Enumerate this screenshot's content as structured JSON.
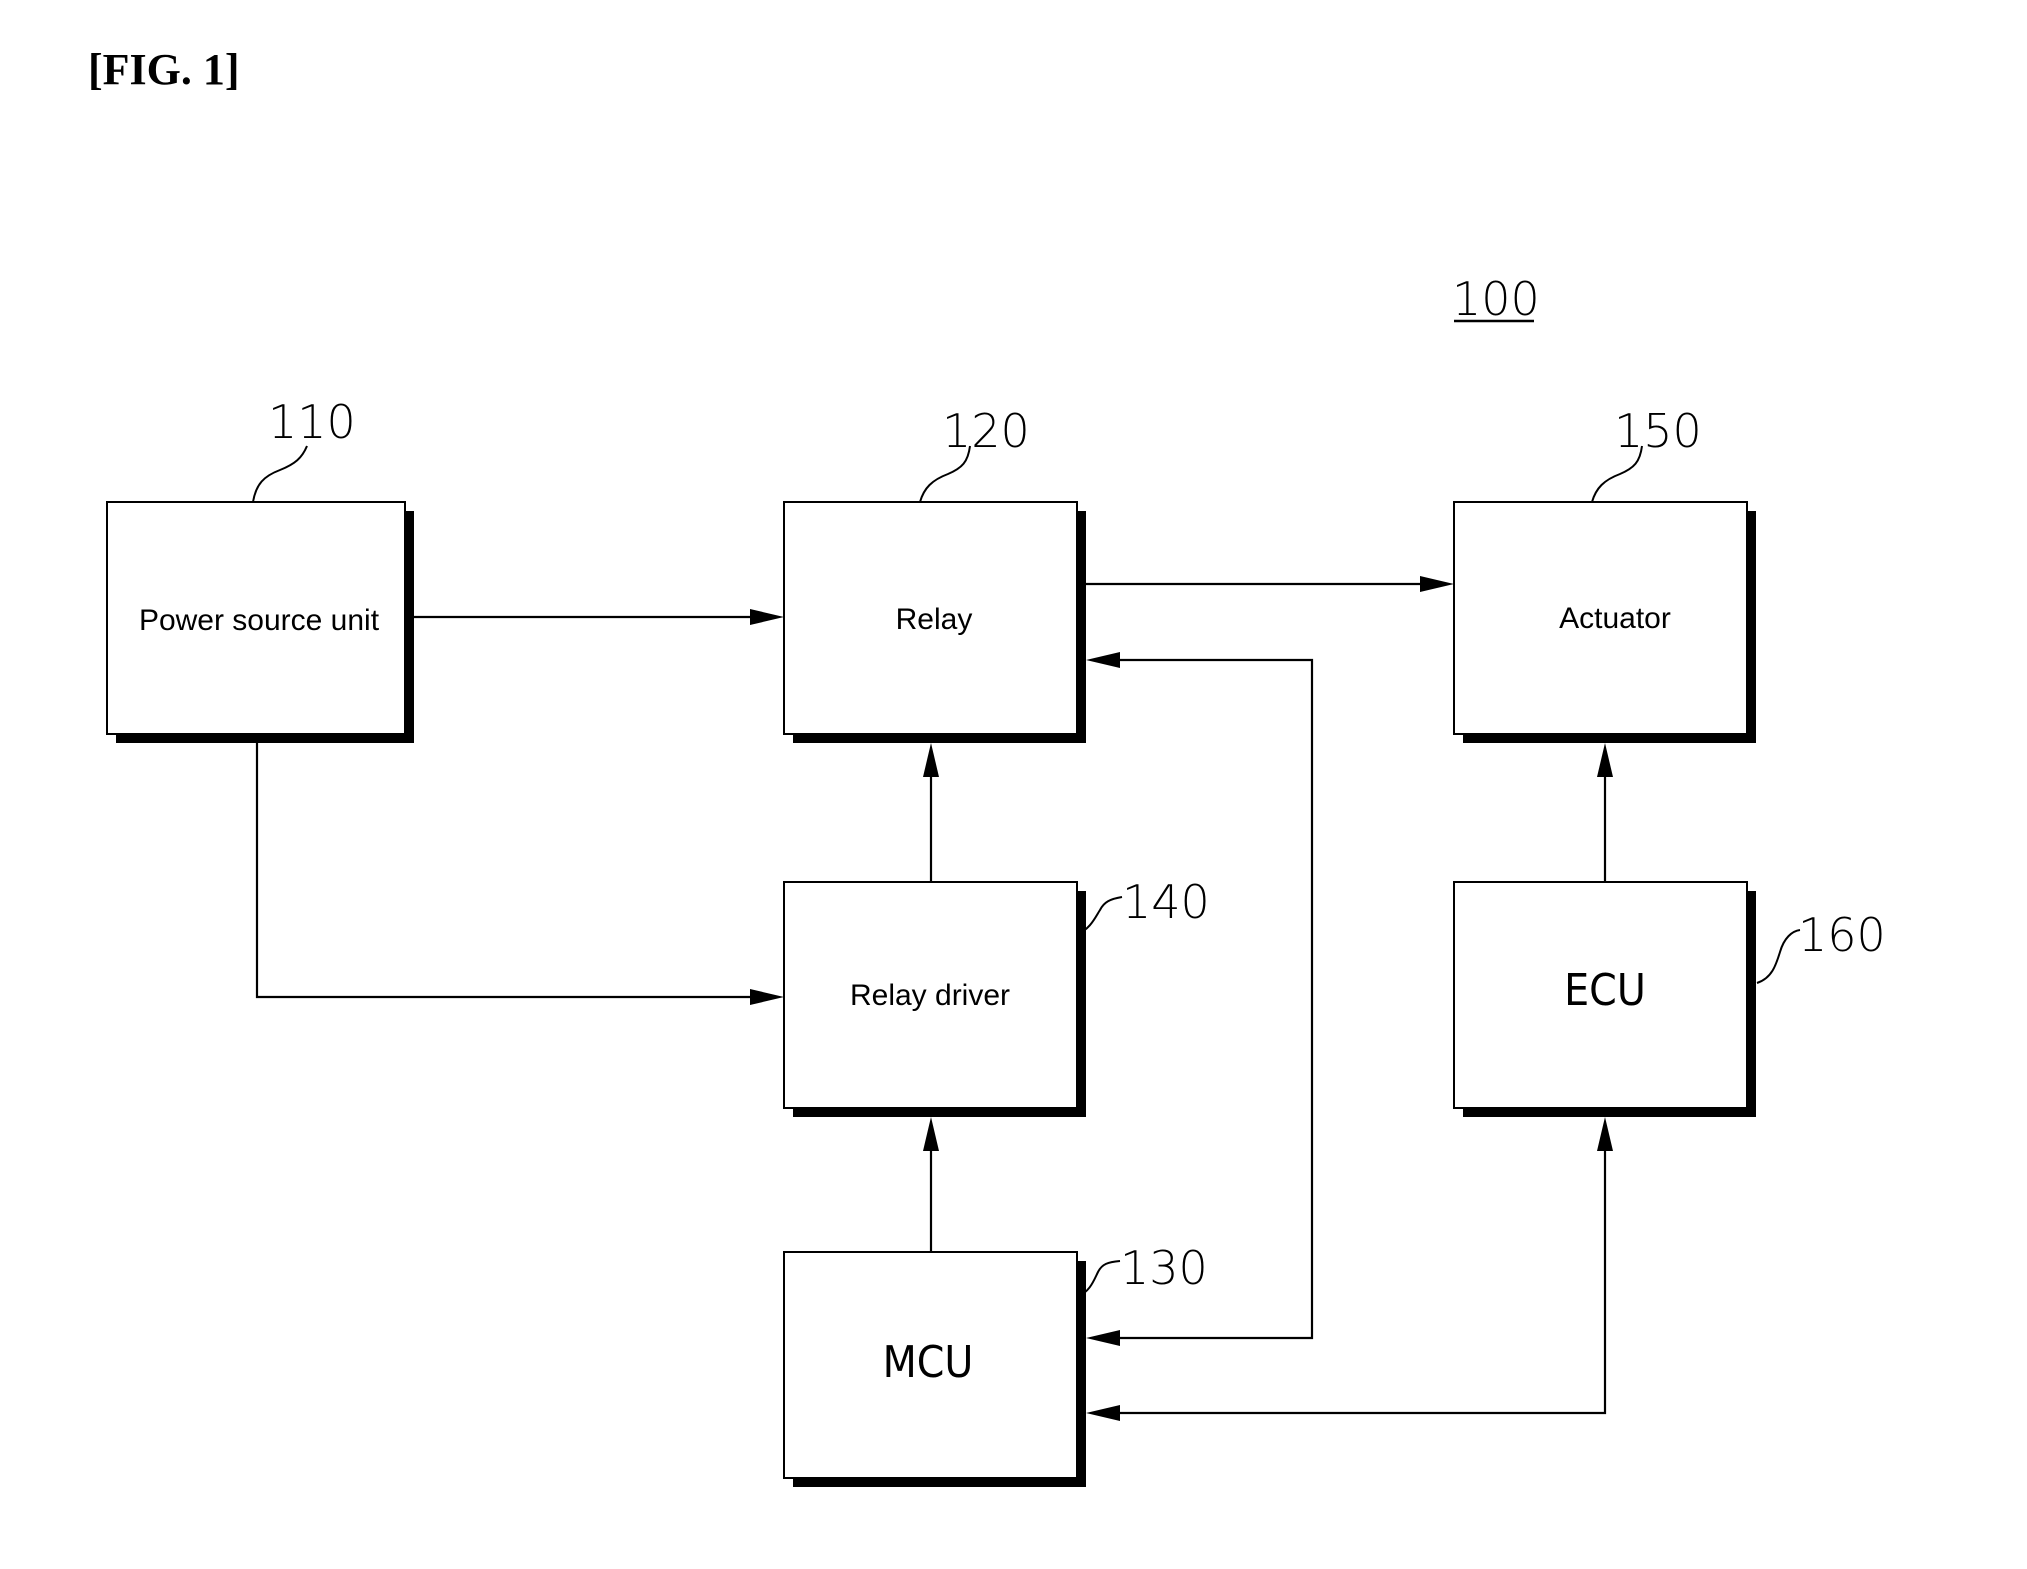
{
  "figure": {
    "title": "[FIG. 1]",
    "system_ref": "100"
  },
  "blocks": {
    "power_source": {
      "label": "Power source unit",
      "ref": "110"
    },
    "relay": {
      "label": "Relay",
      "ref": "120"
    },
    "mcu": {
      "label": "MCU",
      "ref": "130"
    },
    "relay_driver": {
      "label": "Relay driver",
      "ref": "140"
    },
    "actuator": {
      "label": "Actuator",
      "ref": "150"
    },
    "ecu": {
      "label": "ECU",
      "ref": "160"
    }
  },
  "connections": [
    {
      "from": "Power source unit",
      "to": "Relay"
    },
    {
      "from": "Power source unit",
      "to": "Relay driver"
    },
    {
      "from": "Relay driver",
      "to": "Relay"
    },
    {
      "from": "MCU",
      "to": "Relay driver"
    },
    {
      "from": "MCU",
      "to": "Relay"
    },
    {
      "from": "Relay",
      "to": "Actuator"
    },
    {
      "from": "ECU",
      "to": "Actuator"
    },
    {
      "from": "ECU",
      "to": "MCU"
    }
  ]
}
